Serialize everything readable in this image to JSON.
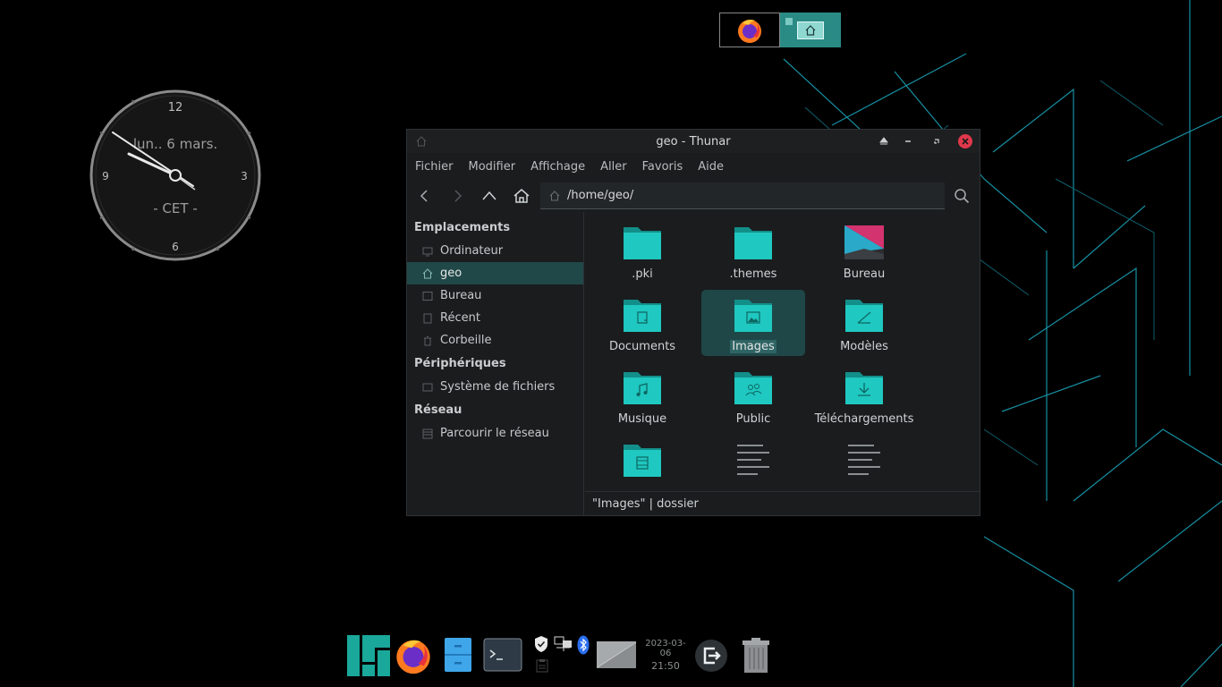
{
  "clock": {
    "day_label": "lun..  6 mars.",
    "tz_label": "- CET -",
    "n12": "12",
    "n3": "3",
    "n6": "6",
    "n9": "9"
  },
  "window": {
    "title": "geo - Thunar",
    "menu": [
      "Fichier",
      "Modifier",
      "Affichage",
      "Aller",
      "Favoris",
      "Aide"
    ],
    "path": "/home/geo/",
    "sidebar": {
      "places_head": "Emplacements",
      "places": [
        "Ordinateur",
        "geo",
        "Bureau",
        "Récent",
        "Corbeille"
      ],
      "devices_head": "Périphériques",
      "devices": [
        "Système de fichiers"
      ],
      "network_head": "Réseau",
      "network": [
        "Parcourir le réseau"
      ]
    },
    "files": [
      ".pki",
      ".themes",
      "Bureau",
      "Documents",
      "Images",
      "Modèles",
      "Musique",
      "Public",
      "Téléchargements",
      "",
      "",
      ""
    ],
    "selected": "Images",
    "status": "\"Images\"  |  dossier"
  },
  "dock": {
    "date": "2023-03-06",
    "time": "21:50"
  },
  "colors": {
    "accent": "#1fc8c0",
    "folder_top": "#16a6a0",
    "selection": "#1f4747",
    "close": "#e0384b"
  }
}
